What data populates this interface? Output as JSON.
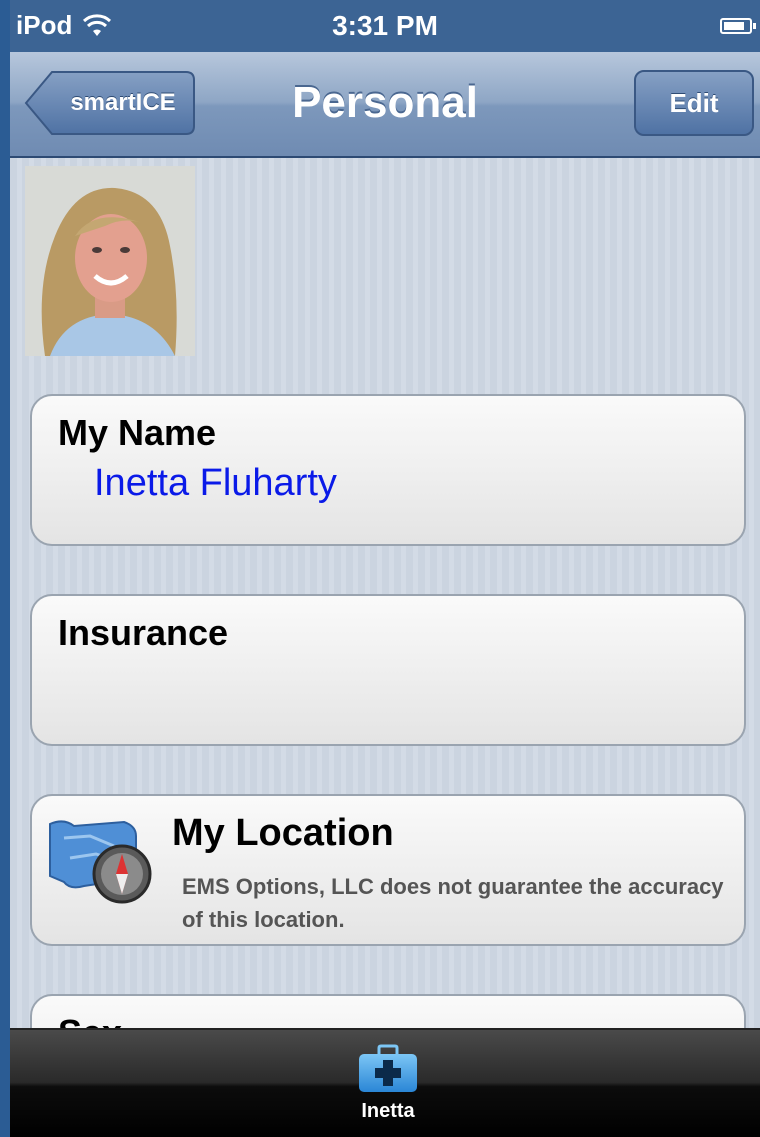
{
  "status_bar": {
    "carrier": "iPod",
    "time": "3:31 PM",
    "wifi_icon": "wifi-icon",
    "battery_icon": "battery-icon"
  },
  "nav": {
    "back_label": "smartICE",
    "title": "Personal",
    "edit_label": "Edit"
  },
  "profile": {
    "photo": "profile-photo"
  },
  "cards": {
    "name": {
      "title": "My Name",
      "value": "Inetta Fluharty"
    },
    "insurance": {
      "title": "Insurance",
      "value": ""
    },
    "location": {
      "title": "My Location",
      "description": "EMS Options, LLC does not guarantee the accuracy of this location.",
      "icon": "map-compass-icon"
    },
    "sex": {
      "title": "Sex"
    }
  },
  "tab_bar": {
    "items": [
      {
        "label": "Inetta",
        "icon": "medical-kit-icon"
      }
    ]
  },
  "colors": {
    "nav_bar": "#8ea6c5",
    "link_value": "#0a1ae8",
    "tab_bar": "#111111"
  }
}
